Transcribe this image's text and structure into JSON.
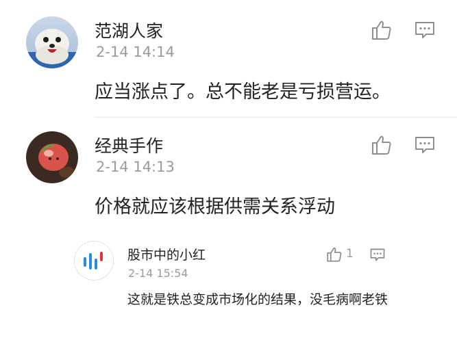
{
  "comments": [
    {
      "name": "范湖人家",
      "time": "2-14 14:14",
      "text": "应当涨点了。总不能老是亏损营运。",
      "avatar": "seal-photo"
    },
    {
      "name": "经典手作",
      "time": "2-14 14:13",
      "text": "价格就应该根据供需关系浮动",
      "avatar": "apple-photo"
    }
  ],
  "replies": [
    {
      "name": "股市中的小红",
      "time": "2-14 15:54",
      "text": "这就是铁总变成市场化的结果，没毛病啊老铁",
      "like_count": "1",
      "avatar": "bar-logo"
    }
  ],
  "icons": {
    "like": "thumbs-up-icon",
    "reply": "comment-icon"
  },
  "colors": {
    "name_text": "#222222",
    "time_text": "#9b9b9b",
    "icon_stroke": "#8e8e8e",
    "divider": "#e6e6e6"
  }
}
